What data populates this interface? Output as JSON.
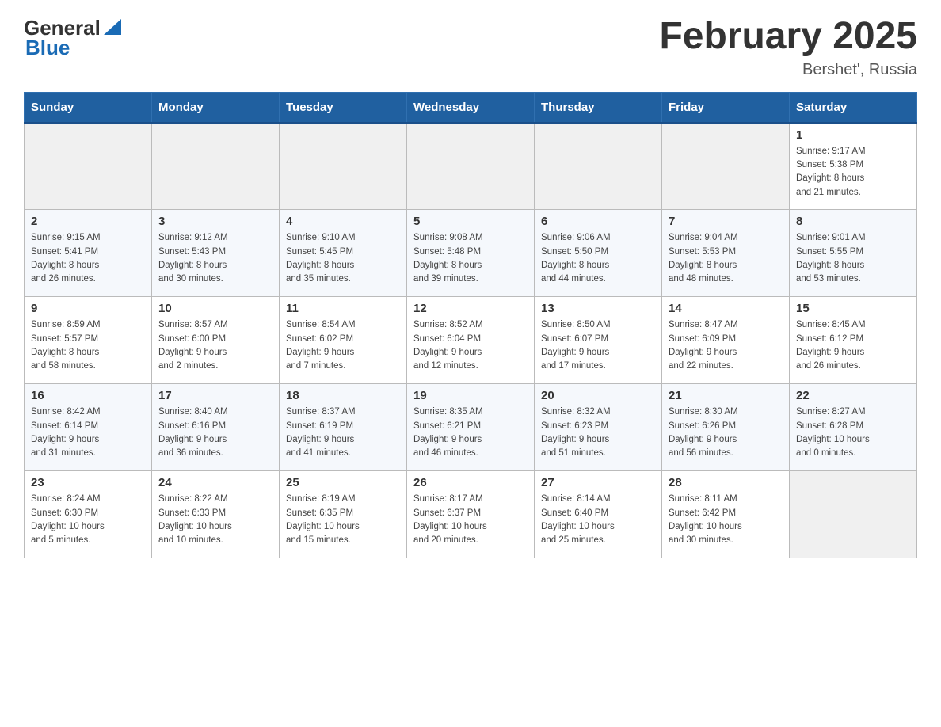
{
  "logo": {
    "general": "General",
    "blue": "Blue"
  },
  "title": "February 2025",
  "location": "Bershet', Russia",
  "days_of_week": [
    "Sunday",
    "Monday",
    "Tuesday",
    "Wednesday",
    "Thursday",
    "Friday",
    "Saturday"
  ],
  "weeks": [
    [
      {
        "day": "",
        "info": ""
      },
      {
        "day": "",
        "info": ""
      },
      {
        "day": "",
        "info": ""
      },
      {
        "day": "",
        "info": ""
      },
      {
        "day": "",
        "info": ""
      },
      {
        "day": "",
        "info": ""
      },
      {
        "day": "1",
        "info": "Sunrise: 9:17 AM\nSunset: 5:38 PM\nDaylight: 8 hours\nand 21 minutes."
      }
    ],
    [
      {
        "day": "2",
        "info": "Sunrise: 9:15 AM\nSunset: 5:41 PM\nDaylight: 8 hours\nand 26 minutes."
      },
      {
        "day": "3",
        "info": "Sunrise: 9:12 AM\nSunset: 5:43 PM\nDaylight: 8 hours\nand 30 minutes."
      },
      {
        "day": "4",
        "info": "Sunrise: 9:10 AM\nSunset: 5:45 PM\nDaylight: 8 hours\nand 35 minutes."
      },
      {
        "day": "5",
        "info": "Sunrise: 9:08 AM\nSunset: 5:48 PM\nDaylight: 8 hours\nand 39 minutes."
      },
      {
        "day": "6",
        "info": "Sunrise: 9:06 AM\nSunset: 5:50 PM\nDaylight: 8 hours\nand 44 minutes."
      },
      {
        "day": "7",
        "info": "Sunrise: 9:04 AM\nSunset: 5:53 PM\nDaylight: 8 hours\nand 48 minutes."
      },
      {
        "day": "8",
        "info": "Sunrise: 9:01 AM\nSunset: 5:55 PM\nDaylight: 8 hours\nand 53 minutes."
      }
    ],
    [
      {
        "day": "9",
        "info": "Sunrise: 8:59 AM\nSunset: 5:57 PM\nDaylight: 8 hours\nand 58 minutes."
      },
      {
        "day": "10",
        "info": "Sunrise: 8:57 AM\nSunset: 6:00 PM\nDaylight: 9 hours\nand 2 minutes."
      },
      {
        "day": "11",
        "info": "Sunrise: 8:54 AM\nSunset: 6:02 PM\nDaylight: 9 hours\nand 7 minutes."
      },
      {
        "day": "12",
        "info": "Sunrise: 8:52 AM\nSunset: 6:04 PM\nDaylight: 9 hours\nand 12 minutes."
      },
      {
        "day": "13",
        "info": "Sunrise: 8:50 AM\nSunset: 6:07 PM\nDaylight: 9 hours\nand 17 minutes."
      },
      {
        "day": "14",
        "info": "Sunrise: 8:47 AM\nSunset: 6:09 PM\nDaylight: 9 hours\nand 22 minutes."
      },
      {
        "day": "15",
        "info": "Sunrise: 8:45 AM\nSunset: 6:12 PM\nDaylight: 9 hours\nand 26 minutes."
      }
    ],
    [
      {
        "day": "16",
        "info": "Sunrise: 8:42 AM\nSunset: 6:14 PM\nDaylight: 9 hours\nand 31 minutes."
      },
      {
        "day": "17",
        "info": "Sunrise: 8:40 AM\nSunset: 6:16 PM\nDaylight: 9 hours\nand 36 minutes."
      },
      {
        "day": "18",
        "info": "Sunrise: 8:37 AM\nSunset: 6:19 PM\nDaylight: 9 hours\nand 41 minutes."
      },
      {
        "day": "19",
        "info": "Sunrise: 8:35 AM\nSunset: 6:21 PM\nDaylight: 9 hours\nand 46 minutes."
      },
      {
        "day": "20",
        "info": "Sunrise: 8:32 AM\nSunset: 6:23 PM\nDaylight: 9 hours\nand 51 minutes."
      },
      {
        "day": "21",
        "info": "Sunrise: 8:30 AM\nSunset: 6:26 PM\nDaylight: 9 hours\nand 56 minutes."
      },
      {
        "day": "22",
        "info": "Sunrise: 8:27 AM\nSunset: 6:28 PM\nDaylight: 10 hours\nand 0 minutes."
      }
    ],
    [
      {
        "day": "23",
        "info": "Sunrise: 8:24 AM\nSunset: 6:30 PM\nDaylight: 10 hours\nand 5 minutes."
      },
      {
        "day": "24",
        "info": "Sunrise: 8:22 AM\nSunset: 6:33 PM\nDaylight: 10 hours\nand 10 minutes."
      },
      {
        "day": "25",
        "info": "Sunrise: 8:19 AM\nSunset: 6:35 PM\nDaylight: 10 hours\nand 15 minutes."
      },
      {
        "day": "26",
        "info": "Sunrise: 8:17 AM\nSunset: 6:37 PM\nDaylight: 10 hours\nand 20 minutes."
      },
      {
        "day": "27",
        "info": "Sunrise: 8:14 AM\nSunset: 6:40 PM\nDaylight: 10 hours\nand 25 minutes."
      },
      {
        "day": "28",
        "info": "Sunrise: 8:11 AM\nSunset: 6:42 PM\nDaylight: 10 hours\nand 30 minutes."
      },
      {
        "day": "",
        "info": ""
      }
    ]
  ]
}
